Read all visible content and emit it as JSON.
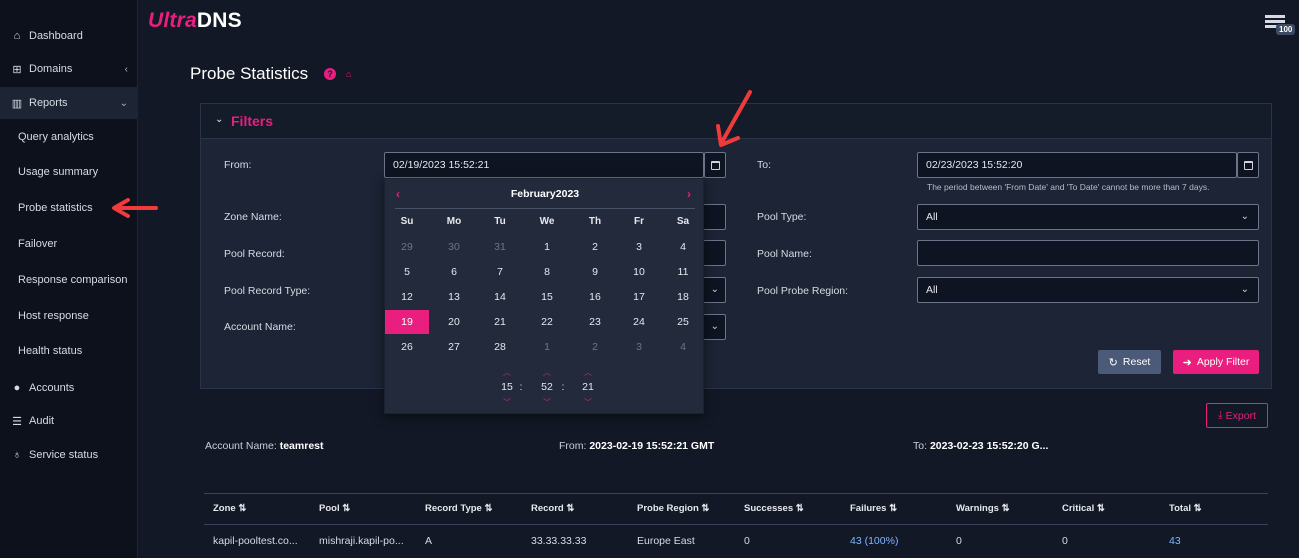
{
  "brand": {
    "ultra": "Ultra",
    "dns": "DNS"
  },
  "topbar": {
    "badge": "100"
  },
  "sidebar": {
    "items": [
      {
        "label": "Dashboard",
        "icon": "home-icon"
      },
      {
        "label": "Domains",
        "icon": "sitemap-icon"
      },
      {
        "label": "Reports",
        "icon": "chart-icon"
      },
      {
        "label": "Accounts",
        "icon": "user-icon"
      },
      {
        "label": "Audit",
        "icon": "list-icon"
      },
      {
        "label": "Service status",
        "icon": "stethoscope-icon"
      }
    ],
    "reports_sub": [
      "Query analytics",
      "Usage summary",
      "Probe statistics",
      "Failover",
      "Response comparison",
      "Host response",
      "Health status"
    ]
  },
  "page": {
    "title": "Probe Statistics"
  },
  "filters": {
    "title": "Filters",
    "from_label": "From:",
    "from_value": "02/19/2023 15:52:21",
    "to_label": "To:",
    "to_value": "02/23/2023 15:52:20",
    "hint": "The period between 'From Date' and 'To Date' cannot be more than 7 days.",
    "zone_name_label": "Zone Name:",
    "pool_type_label": "Pool Type:",
    "pool_type_value": "All",
    "pool_record_label": "Pool Record:",
    "pool_name_label": "Pool Name:",
    "pool_record_type_label": "Pool Record Type:",
    "pool_probe_region_label": "Pool Probe Region:",
    "pool_probe_region_value": "All",
    "account_name_label": "Account Name:",
    "reset_label": "Reset",
    "apply_label": "Apply Filter"
  },
  "datepicker": {
    "month_label": "February2023",
    "weekdays": [
      "Su",
      "Mo",
      "Tu",
      "We",
      "Th",
      "Fr",
      "Sa"
    ],
    "weeks": [
      [
        "29",
        "30",
        "31",
        "1",
        "2",
        "3",
        "4"
      ],
      [
        "5",
        "6",
        "7",
        "8",
        "9",
        "10",
        "11"
      ],
      [
        "12",
        "13",
        "14",
        "15",
        "16",
        "17",
        "18"
      ],
      [
        "19",
        "20",
        "21",
        "22",
        "23",
        "24",
        "25"
      ],
      [
        "26",
        "27",
        "28",
        "1",
        "2",
        "3",
        "4"
      ]
    ],
    "selected_day": "19",
    "time": {
      "hour": "15",
      "minute": "52",
      "second": "21"
    }
  },
  "export_label": "Export",
  "summary": {
    "account_label": "Account Name:",
    "account_value": "teamrest",
    "from_label": "From:",
    "from_value": "2023-02-19 15:52:21 GMT",
    "to_label": "To:",
    "to_value": "2023-02-23 15:52:20 G..."
  },
  "table": {
    "headers": [
      "Zone ⇅",
      "Pool ⇅",
      "Record Type ⇅",
      "Record ⇅",
      "Probe Region ⇅",
      "Successes ⇅",
      "Failures ⇅",
      "Warnings ⇅",
      "Critical ⇅",
      "Total ⇅"
    ],
    "row": [
      "kapil-pooltest.co...",
      "mishraji.kapil-po...",
      "A",
      "33.33.33.33",
      "Europe East",
      "0",
      "43 (100%)",
      "0",
      "0",
      "43"
    ]
  },
  "colors": {
    "accent": "#e91e7f",
    "arrow": "#ef3b3b",
    "background": "#121826",
    "link": "#7fb6ff"
  }
}
